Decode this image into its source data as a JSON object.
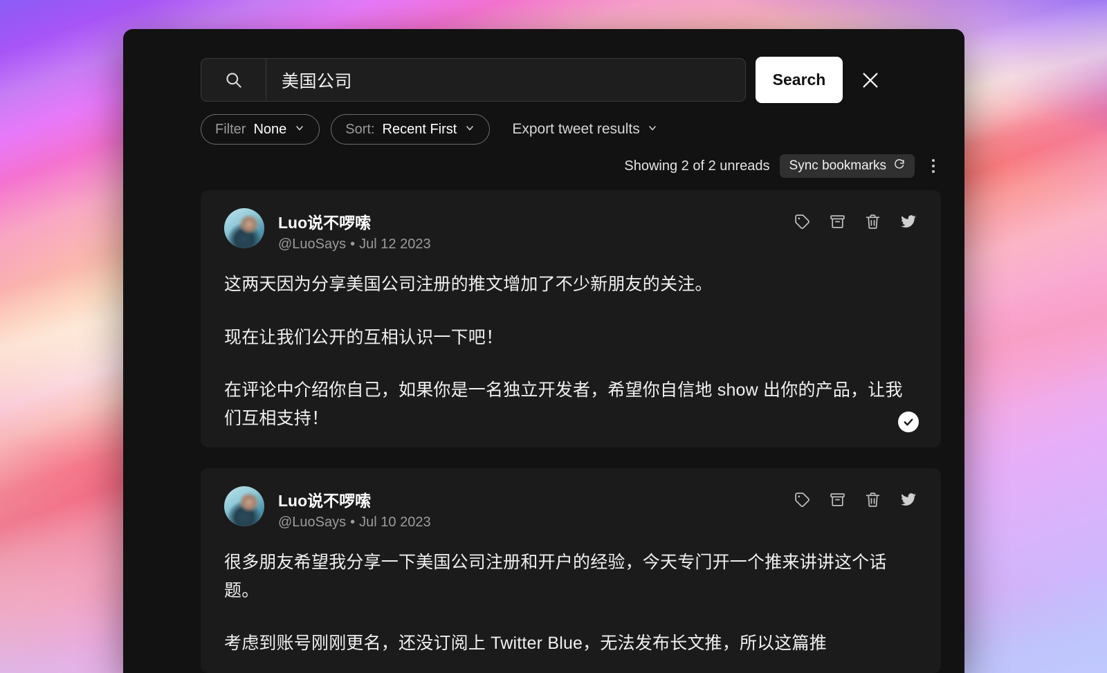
{
  "search": {
    "icon": "search-icon",
    "value": "美国公司",
    "placeholder": "Search",
    "button_label": "Search",
    "close_icon": "close-icon"
  },
  "filters": {
    "filter_label": "Filter",
    "filter_value": "None",
    "sort_label": "Sort:",
    "sort_value": "Recent First",
    "export_label": "Export tweet results",
    "chevron_icon": "chevron-down-icon"
  },
  "status": {
    "showing_text": "Showing 2 of 2 unreads",
    "sync_label": "Sync bookmarks",
    "sync_icon": "sync-icon",
    "menu_icon": "kebab-menu-icon"
  },
  "action_icons": {
    "tag": "tag-icon",
    "archive": "archive-icon",
    "delete": "trash-icon",
    "twitter": "twitter-bird-icon"
  },
  "colors": {
    "window_bg": "#121212",
    "card_bg": "#1b1b1b",
    "accent_button": "#ffffff",
    "muted_text": "#9b9b9b",
    "body_text": "#f0f0f0"
  },
  "tweets": [
    {
      "display_name": "Luo说不啰嗦",
      "handle": "@LuoSays",
      "separator": "•",
      "date": "Jul 12 2023",
      "avatar": "user-avatar",
      "paragraphs": [
        "这两天因为分享美国公司注册的推文增加了不少新朋友的关注。",
        "现在让我们公开的互相认识一下吧！",
        "在评论中介绍你自己，如果你是一名独立开发者，希望你自信地 show 出你的产品，让我们互相支持！"
      ],
      "read_badge": "check-icon"
    },
    {
      "display_name": "Luo说不啰嗦",
      "handle": "@LuoSays",
      "separator": "•",
      "date": "Jul 10 2023",
      "avatar": "user-avatar",
      "paragraphs": [
        "很多朋友希望我分享一下美国公司注册和开户的经验，今天专门开一个推来讲讲这个话题。",
        "考虑到账号刚刚更名，还没订阅上 Twitter Blue，无法发布长文推，所以这篇推"
      ],
      "read_badge": null
    }
  ]
}
